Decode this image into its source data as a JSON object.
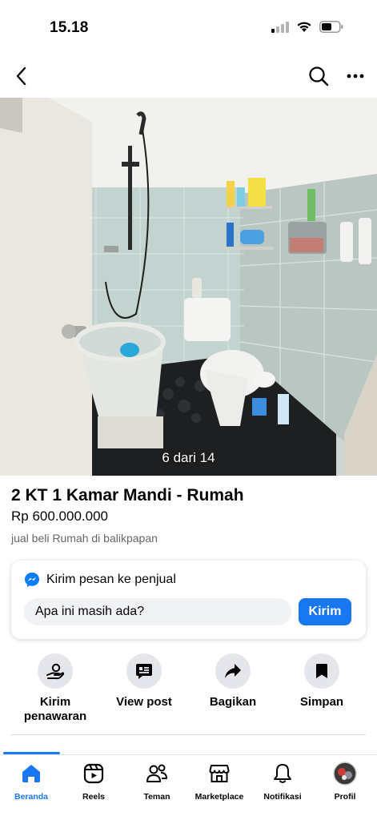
{
  "status_bar": {
    "time": "15.18"
  },
  "listing": {
    "photo_counter": "6 dari 14",
    "title": "2 KT 1 Kamar Mandi - Rumah",
    "price": "Rp 600.000.000",
    "category": "jual beli Rumah di balikpapan"
  },
  "message_card": {
    "header": "Kirim pesan ke penjual",
    "input_value": "Apa ini masih ada?",
    "send_label": "Kirim"
  },
  "actions": [
    {
      "label": "Kirim\npenawaran",
      "icon": "offer-hand-icon"
    },
    {
      "label": "View post",
      "icon": "post-icon"
    },
    {
      "label": "Bagikan",
      "icon": "share-icon"
    },
    {
      "label": "Simpan",
      "icon": "bookmark-icon"
    }
  ],
  "tabs": [
    {
      "label": "Beranda",
      "icon": "home-icon",
      "active": true
    },
    {
      "label": "Reels",
      "icon": "reels-icon"
    },
    {
      "label": "Teman",
      "icon": "friends-icon"
    },
    {
      "label": "Marketplace",
      "icon": "marketplace-icon"
    },
    {
      "label": "Notifikasi",
      "icon": "bell-icon"
    },
    {
      "label": "Profil",
      "icon": "profile-avatar"
    }
  ],
  "colors": {
    "accent": "#1877f2",
    "text": "#050505",
    "secondary_text": "#65676b"
  }
}
